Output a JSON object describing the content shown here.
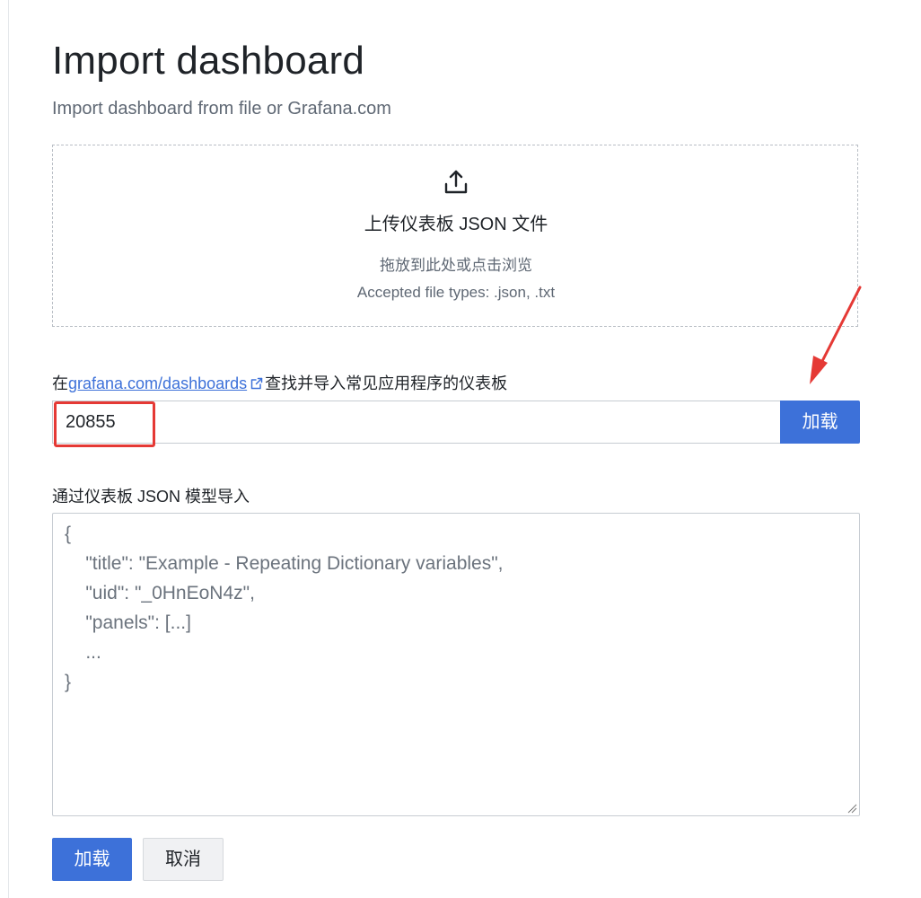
{
  "page": {
    "title": "Import dashboard",
    "subtitle": "Import dashboard from file or Grafana.com"
  },
  "upload": {
    "icon": "upload-icon",
    "heading": "上传仪表板 JSON 文件",
    "browse_text": "拖放到此处或点击浏览",
    "accepted_types": "Accepted file types: .json, .txt"
  },
  "gcom": {
    "label_prefix": "在",
    "link_text": "grafana.com/dashboards",
    "link_icon": "external-link-icon",
    "label_suffix": "查找并导入常见应用程序的仪表板",
    "input_value": "20855",
    "load_label": "加载"
  },
  "json_model": {
    "label": "通过仪表板 JSON 模型导入",
    "placeholder_lines": [
      "{",
      "    \"title\": \"Example - Repeating Dictionary variables\",",
      "    \"uid\": \"_0HnEoN4z\",",
      "    \"panels\": [...]",
      "    ...",
      "}"
    ]
  },
  "footer": {
    "load_label": "加载",
    "cancel_label": "取消"
  },
  "colors": {
    "primary": "#3d71d9",
    "annotation": "#e53935",
    "link": "#3d71d9"
  }
}
